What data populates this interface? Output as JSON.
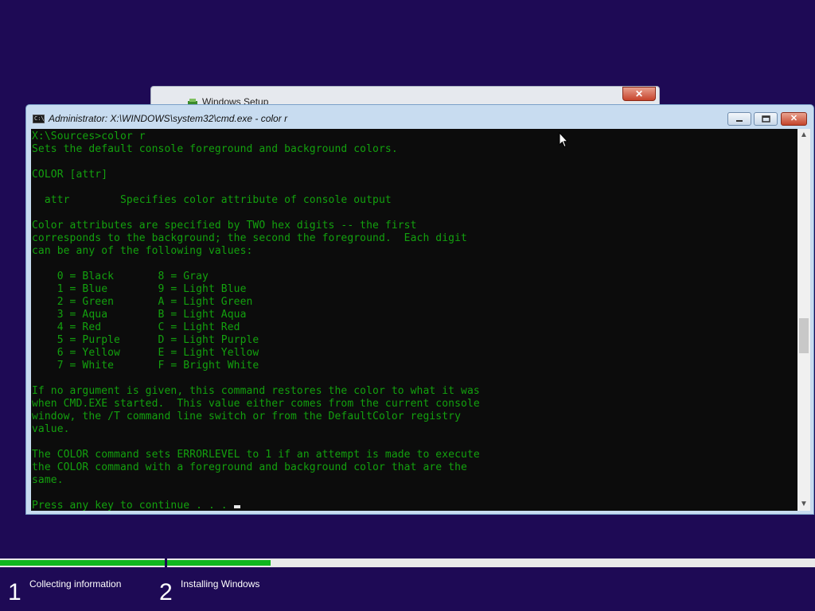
{
  "setup_window": {
    "title": "Windows Setup",
    "close_label": "✕"
  },
  "cmd_window": {
    "title": "Administrator: X:\\WINDOWS\\system32\\cmd.exe - color  r",
    "icon_text": "C:\\",
    "minimize_label": "▭",
    "maximize_label": "▭",
    "close_label": "✕",
    "console_lines": [
      "X:\\Sources>color r",
      "Sets the default console foreground and background colors.",
      "",
      "COLOR [attr]",
      "",
      "  attr        Specifies color attribute of console output",
      "",
      "Color attributes are specified by TWO hex digits -- the first",
      "corresponds to the background; the second the foreground.  Each digit",
      "can be any of the following values:",
      "",
      "    0 = Black       8 = Gray",
      "    1 = Blue        9 = Light Blue",
      "    2 = Green       A = Light Green",
      "    3 = Aqua        B = Light Aqua",
      "    4 = Red         C = Light Red",
      "    5 = Purple      D = Light Purple",
      "    6 = Yellow      E = Light Yellow",
      "    7 = White       F = Bright White",
      "",
      "If no argument is given, this command restores the color to what it was",
      "when CMD.EXE started.  This value either comes from the current console",
      "window, the /T command line switch or from the DefaultColor registry",
      "value.",
      "",
      "The COLOR command sets ERRORLEVEL to 1 if an attempt is made to execute",
      "the COLOR command with a foreground and background color that are the",
      "same.",
      "",
      "Press any key to continue . . . "
    ],
    "text_color": "#13a10e",
    "background_color": "#0c0c0c"
  },
  "progress": {
    "steps": [
      {
        "number": "1",
        "label": "Collecting information",
        "fill": 1.0
      },
      {
        "number": "2",
        "label": "Installing Windows",
        "fill": 0.16
      }
    ],
    "fill_color": "#10b61e"
  },
  "colors": {
    "desktop_background": "#1e0a55"
  }
}
